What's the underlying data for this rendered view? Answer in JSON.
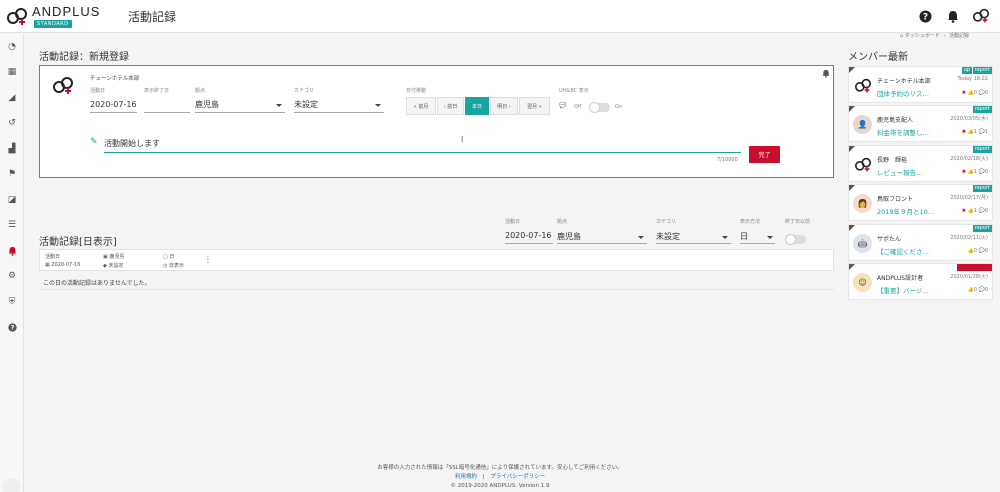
{
  "app": {
    "logo_text": "ANDPLUS",
    "logo_badge": "STANDARD",
    "page_title": "活動記録",
    "brand_color": "#1aa3a3",
    "accent_color": "#c8102e"
  },
  "top_icons": [
    "help-icon",
    "bell-icon",
    "andplus-logo-icon"
  ],
  "sidebar": {
    "items": [
      {
        "icon": "dashboard-icon",
        "glyph": "◔"
      },
      {
        "icon": "calendar-icon",
        "glyph": "▦"
      },
      {
        "icon": "tag-icon",
        "glyph": "◢"
      },
      {
        "icon": "history-icon",
        "glyph": "↺"
      },
      {
        "icon": "chart-icon",
        "glyph": "▟"
      },
      {
        "icon": "flag-icon",
        "glyph": "⚑"
      },
      {
        "icon": "edit-icon",
        "glyph": "◪"
      },
      {
        "icon": "list-icon",
        "glyph": "☰"
      },
      {
        "icon": "bell-icon",
        "glyph": "🔔",
        "active": true
      },
      {
        "icon": "gear-icon",
        "glyph": "⚙"
      },
      {
        "icon": "shield-icon",
        "glyph": "⛨"
      },
      {
        "icon": "question-icon",
        "glyph": "?"
      }
    ]
  },
  "breadcrumb": {
    "home": "ダッシュボード",
    "separator": "›",
    "current": "活動記録"
  },
  "register": {
    "heading": "活動記録：新規登録",
    "org_name": "チェーンホテル本部",
    "fields": {
      "date_label": "活動日",
      "date_value": "2020-07-16",
      "end_date_label": "表示終了日",
      "end_date_value": "",
      "base_label": "拠点",
      "base_value": "鹿児島",
      "category_label": "カテゴリ",
      "category_value": "未設定",
      "date_move_label": "日付移動",
      "uh_label": "UH&BC 表示",
      "toggle_off": "Off",
      "toggle_on": "On"
    },
    "date_buttons": [
      {
        "label": "« 前月"
      },
      {
        "label": "‹ 前日"
      },
      {
        "label": "本日",
        "active": true
      },
      {
        "label": "明日 ›"
      },
      {
        "label": "翌月 »"
      }
    ],
    "memo_text": "活動開始します",
    "char_count": "7/10000",
    "done_label": "完了"
  },
  "day_view": {
    "heading": "活動記録[日表示]",
    "filters": {
      "date_label": "活動日",
      "date_value": "2020-07-16",
      "base_label": "拠点",
      "base_value": "鹿児島",
      "category_label": "カテゴリ",
      "category_value": "未設定",
      "display_label": "表示方法",
      "display_value": "日",
      "end_label": "終了日以前"
    },
    "meta": {
      "date_label": "活動日",
      "date_value": "2020-07-16",
      "base_label": "鹿児島",
      "category_label": "未設定",
      "unit_label": "日",
      "hidden_label": "非表示"
    },
    "empty_message": "この日の活動記録はありませんでした。"
  },
  "members": {
    "title": "メンバー最新",
    "cards": [
      {
        "name": "チェーンホテル本部",
        "date": "Today 18:22",
        "line": "団体予約のリス…",
        "tags": [
          "up",
          "report"
        ],
        "likes": "0",
        "comments": "0",
        "avatar": "logo"
      },
      {
        "name": "鹿児島支配人",
        "date": "2020/03/05(木)",
        "line": "料金帯を調整し…",
        "tags": [
          "report"
        ],
        "likes": "1",
        "comments": "1",
        "avatar": "person"
      },
      {
        "name": "長野　輝裕",
        "date": "2020/02/18(火)",
        "line": "レビュー報告…",
        "tags": [
          "report"
        ],
        "likes": "1",
        "comments": "0",
        "avatar": "logo"
      },
      {
        "name": "鳥取フロント",
        "date": "2020/02/17(月)",
        "line": "2019年９月と10…",
        "tags": [
          "report"
        ],
        "likes": "1",
        "comments": "0",
        "avatar": "person"
      },
      {
        "name": "サポたん",
        "date": "2020/02/11(火)",
        "line": "【ご確認くださ…",
        "tags": [
          "report"
        ],
        "likes": "0",
        "comments": "0",
        "avatar": "robot"
      },
      {
        "name": "ANDPLUS設計者",
        "date": "2020/01/28(火)",
        "line": "【重要】バージ…",
        "tags": [
          "red"
        ],
        "likes": "0",
        "comments": "0",
        "avatar": "face"
      }
    ]
  },
  "footer": {
    "notice": "お客様の入力された情報は「SSL暗号化通信」により保護されています。安心してご利用ください。",
    "terms": "利用規約",
    "divider": "|",
    "privacy": "プライバシーポリシー",
    "copyright": "© 2019-2020 ANDPLUS. Version 1.9"
  }
}
